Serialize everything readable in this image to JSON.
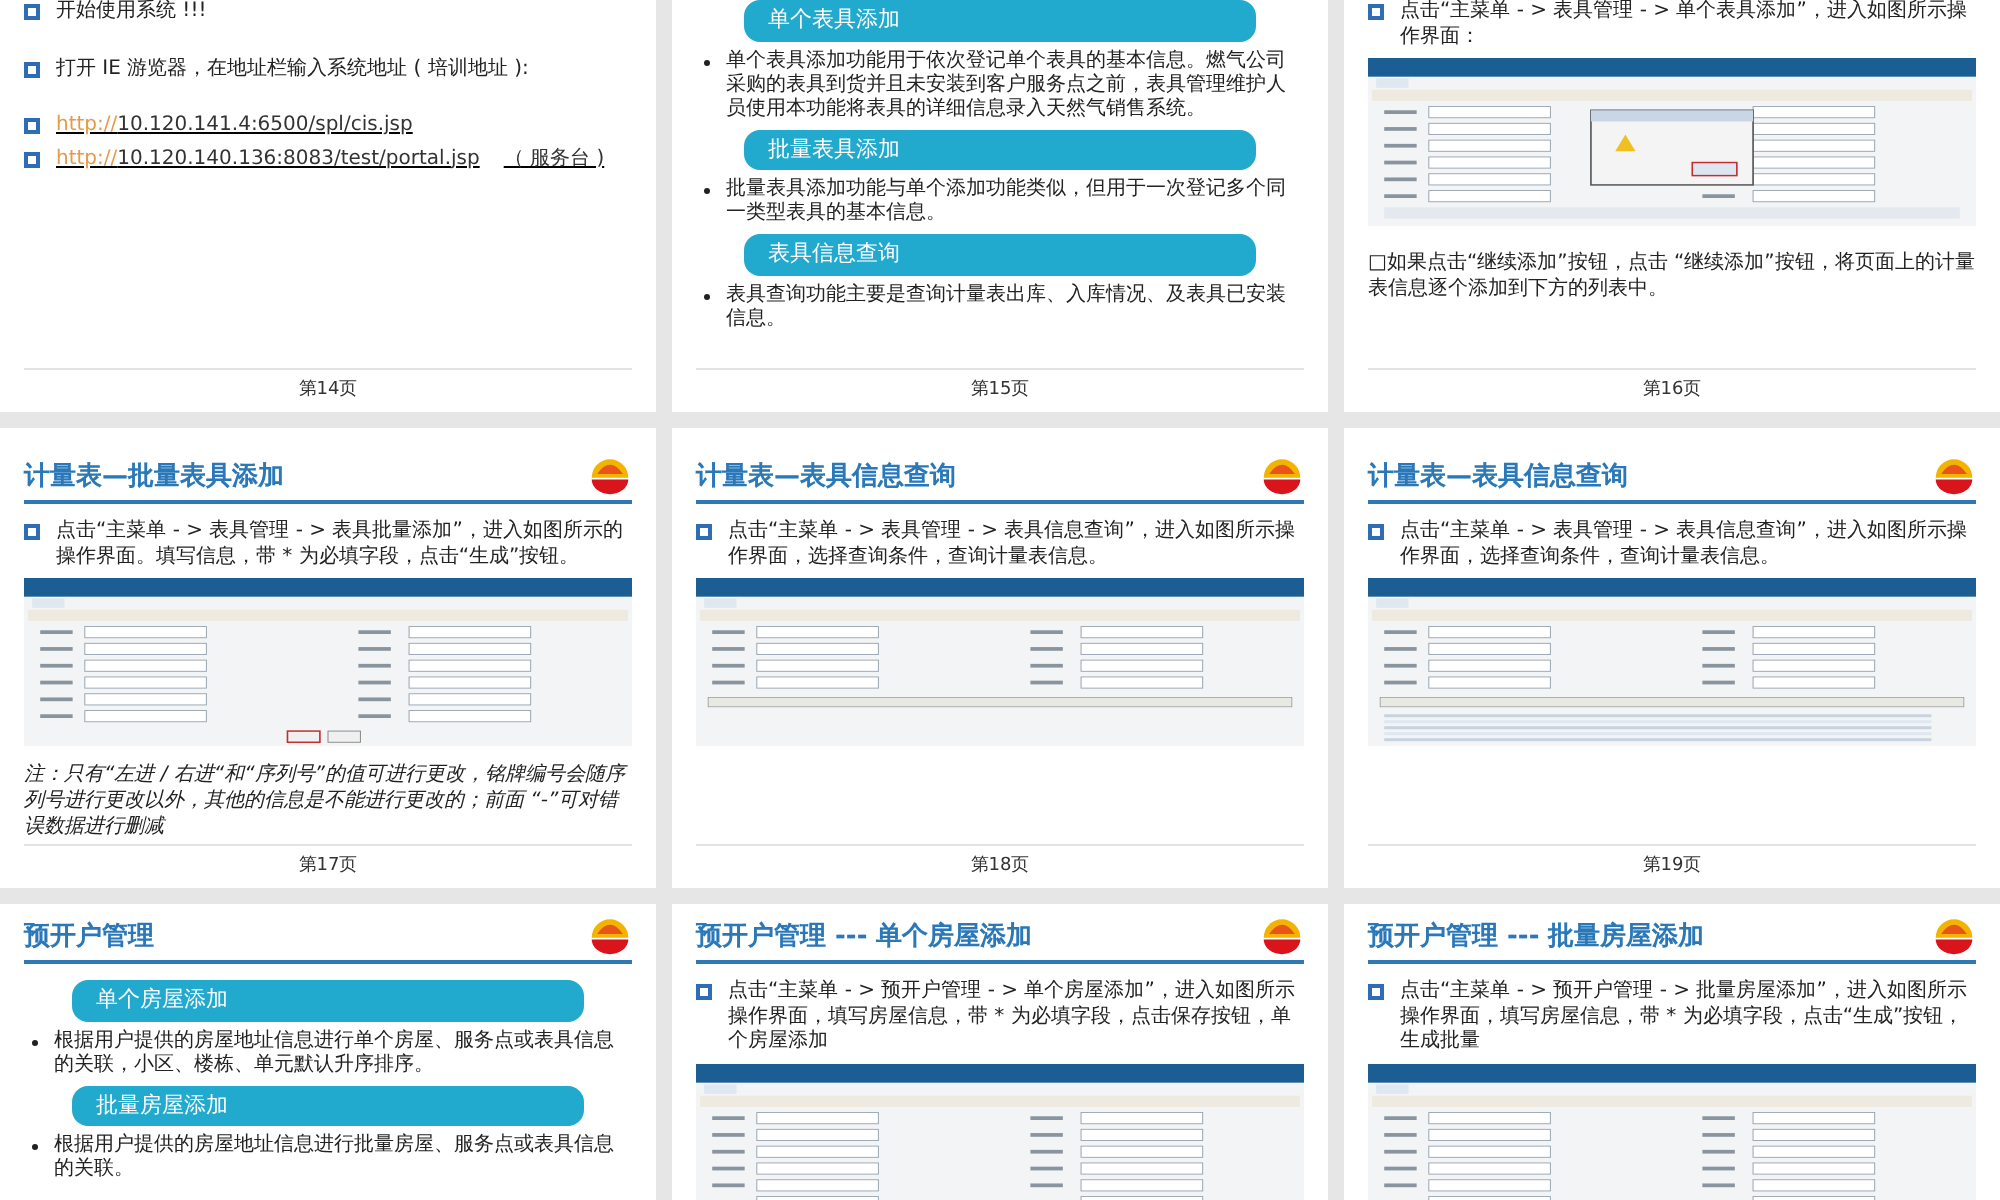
{
  "pages": [
    {
      "label": "第14页",
      "blocks": [
        {
          "kind": "bullet",
          "text": "开始使用系统 !!!"
        },
        {
          "kind": "spacer"
        },
        {
          "kind": "bullet",
          "text": "打开 IE 游览器，在地址栏输入系统地址 ( 培训地址 ):"
        },
        {
          "kind": "spacer"
        },
        {
          "kind": "link",
          "scheme": "http://",
          "address": "10.120.141.4:6500/spl/cis.jsp"
        },
        {
          "kind": "link",
          "scheme": "http://",
          "address": "10.120.140.136:8083/test/portal.jsp",
          "suffix": "（ 服务台 )"
        }
      ]
    },
    {
      "label": "第15页",
      "blocks": [
        {
          "kind": "box",
          "text": "单个表具添加"
        },
        {
          "kind": "note",
          "text": "单个表具添加功能用于依次登记单个表具的基本信息。燃气公司采购的表具到货并且未安装到客户服务点之前，表具管理维护人员使用本功能将表具的详细信息录入天然气销售系统。"
        },
        {
          "kind": "box",
          "text": "批量表具添加"
        },
        {
          "kind": "note",
          "text": "批量表具添加功能与单个添加功能类似，但用于一次登记多个同一类型表具的基本信息。"
        },
        {
          "kind": "box",
          "text": "表具信息查询"
        },
        {
          "kind": "note",
          "text": "表具查询功能主要是查询计量表出库、入库情况、及表具已安装信息。"
        }
      ]
    },
    {
      "label": "第16页",
      "blocks": [
        {
          "kind": "bullet",
          "text": "点击“主菜单 - > 表具管理 - > 单个表具添加”，进入如图所示操作界面："
        },
        {
          "kind": "dialog"
        },
        {
          "kind": "paragraph",
          "text": "□如果点击“继续添加”按钮，点击 “继续添加”按钮，将页面上的计量表信息逐个添加到下方的列表中。"
        }
      ]
    },
    {
      "label": "第17页",
      "title": "计量表—批量表具添加",
      "blocks": [
        {
          "kind": "bullet",
          "text": "点击“主菜单 - > 表具管理 - > 表具批量添加”，进入如图所示的操作界面。填写信息，带 * 为必填字段，点击“生成”按钮。"
        },
        {
          "kind": "form"
        },
        {
          "kind": "remark",
          "text": "注：只有“左进 / 右进“和“序列号”的值可进行更改，铭牌编号会随序列号进行更改以外，其他的信息是不能进行更改的；前面 “-”可对错误数据进行删减"
        }
      ]
    },
    {
      "label": "第18页",
      "title": "计量表—表具信息查询",
      "blocks": [
        {
          "kind": "bullet",
          "text": "点击“主菜单 - > 表具管理 - > 表具信息查询”，进入如图所示操作界面，选择查询条件，查询计量表信息。"
        },
        {
          "kind": "query"
        }
      ]
    },
    {
      "label": "第19页",
      "title": "计量表—表具信息查询",
      "blocks": [
        {
          "kind": "bullet",
          "text": "点击“主菜单 - > 表具管理 - > 表具信息查询”，进入如图所示操作界面，选择查询条件，查询计量表信息。"
        },
        {
          "kind": "table"
        }
      ]
    },
    {
      "title": "预开户管理",
      "blocks": [
        {
          "kind": "box",
          "text": "单个房屋添加"
        },
        {
          "kind": "note",
          "text": "根据用户提供的房屋地址信息进行单个房屋、服务点或表具信息的关联，小区、楼栋、单元默认升序排序。"
        },
        {
          "kind": "box",
          "text": "批量房屋添加"
        },
        {
          "kind": "note",
          "text": "根据用户提供的房屋地址信息进行批量房屋、服务点或表具信息的关联。"
        }
      ]
    },
    {
      "title": "预开户管理 --- 单个房屋添加",
      "blocks": [
        {
          "kind": "bullet",
          "text": "点击“主菜单 - > 预开户管理 - > 单个房屋添加”，进入如图所示操作界面，填写房屋信息，带 * 为必填字段，点击保存按钮，单个房屋添加"
        },
        {
          "kind": "form"
        }
      ]
    },
    {
      "title": "预开户管理 --- 批量房屋添加",
      "blocks": [
        {
          "kind": "bullet",
          "text": "点击“主菜单 - > 预开户管理 - > 批量房屋添加”，进入如图所示操作界面，填写房屋信息，带 * 为必填字段，点击“生成”按钮，生成批量"
        },
        {
          "kind": "form"
        }
      ]
    }
  ]
}
